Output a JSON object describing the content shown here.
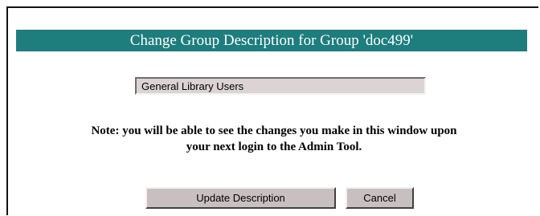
{
  "dialog": {
    "title": "Change Group Description for Group 'doc499'",
    "description_value": "General Library Users",
    "note_line1": "Note: you will be able to see the changes you make in this window upon",
    "note_line2": "your next login to the Admin Tool.",
    "update_label": "Update Description",
    "cancel_label": "Cancel"
  },
  "colors": {
    "title_bar": "#1e7d7d",
    "input_background": "#dcd4d4",
    "button_face": "#c8c0c0"
  }
}
